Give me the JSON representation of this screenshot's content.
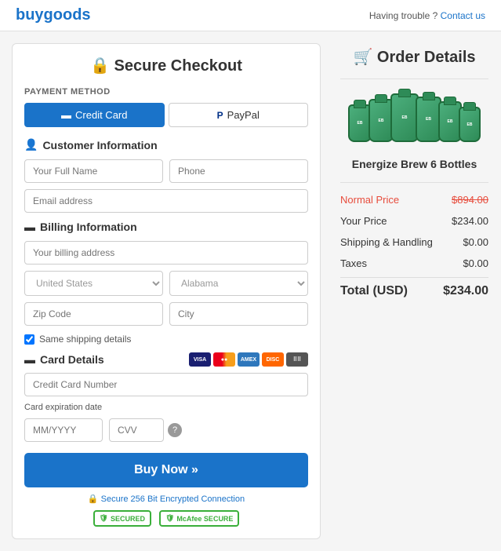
{
  "topBar": {
    "logo": "buygoods",
    "troubleText": "Having trouble ?",
    "contactText": "Contact us"
  },
  "leftPanel": {
    "title": "🔒 Secure Checkout",
    "paymentMethod": {
      "label": "PAYMENT METHOD",
      "tabs": [
        {
          "id": "credit-card",
          "label": "Credit Card",
          "active": true
        },
        {
          "id": "paypal",
          "label": "PayPal",
          "active": false
        }
      ]
    },
    "customerInfo": {
      "heading": "Customer Information",
      "fullNamePlaceholder": "Your Full Name",
      "phonePlaceholder": "Phone",
      "emailPlaceholder": "Email address"
    },
    "billingInfo": {
      "heading": "Billing Information",
      "addressPlaceholder": "Your billing address",
      "countryDefault": "United States",
      "stateDefault": "Alabama",
      "zipPlaceholder": "Zip Code",
      "cityPlaceholder": "City",
      "sameShippingLabel": "Same shipping details"
    },
    "cardDetails": {
      "heading": "Card Details",
      "cardNumberPlaceholder": "Credit Card Number",
      "expiryLabel": "Card expiration date",
      "expiryPlaceholder": "MM/YYYY",
      "cvvPlaceholder": "CVV"
    },
    "buyButton": "Buy Now »",
    "secureText": "🔒 Secure 256 Bit Encrypted Connection",
    "badges": [
      {
        "label": "SECURED"
      },
      {
        "label": "McAfee\nSECURE"
      }
    ]
  },
  "rightPanel": {
    "title": "🛒 Order Details",
    "productName": "Energize Brew 6 Bottles",
    "pricing": {
      "normalPriceLabel": "Normal Price",
      "normalPriceValue": "$894.00",
      "yourPriceLabel": "Your Price",
      "yourPriceValue": "$234.00",
      "shippingLabel": "Shipping & Handling",
      "shippingValue": "$0.00",
      "taxesLabel": "Taxes",
      "taxesValue": "$0.00",
      "totalLabel": "Total (USD)",
      "totalValue": "$234.00"
    }
  }
}
